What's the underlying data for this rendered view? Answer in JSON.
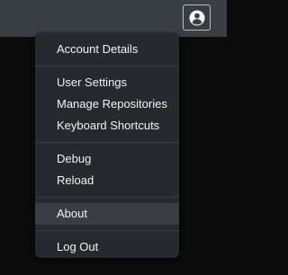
{
  "header": {
    "account_icon": "account-circle-icon"
  },
  "menu": {
    "items": [
      {
        "label": "Account Details"
      },
      {
        "label": "User Settings"
      },
      {
        "label": "Manage Repositories"
      },
      {
        "label": "Keyboard Shortcuts"
      },
      {
        "label": "Debug"
      },
      {
        "label": "Reload"
      },
      {
        "label": "About"
      },
      {
        "label": "Log Out"
      }
    ],
    "active_item": "About"
  },
  "colors": {
    "topbar": "#3a3f45",
    "page_background": "#0b0b0b",
    "menu_background": "#26292d",
    "active_item_background": "#3a3d42",
    "text": "#f2f2f2"
  }
}
